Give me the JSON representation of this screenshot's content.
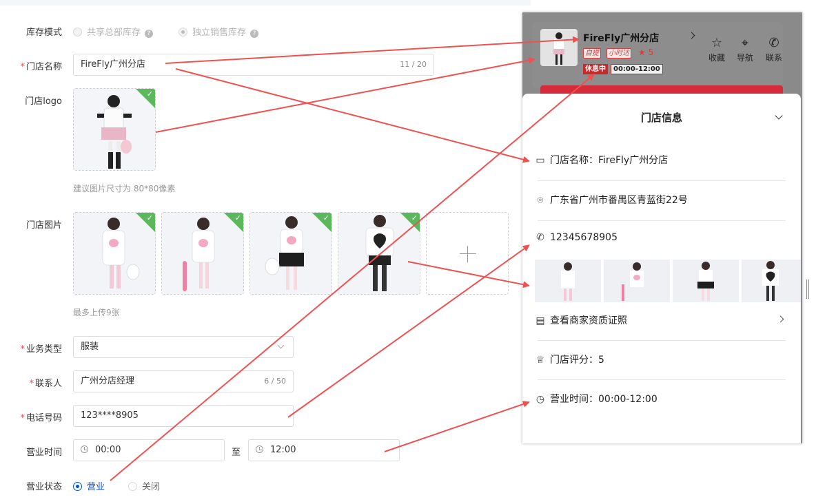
{
  "form": {
    "inventory_mode": {
      "label": "库存模式",
      "opt1": "共享总部库存",
      "opt2": "独立销售库存",
      "q": "?"
    },
    "store_name": {
      "label": "门店名称",
      "value": "FireFly广州分店",
      "count": "11 / 20"
    },
    "logo": {
      "label": "门店logo",
      "hint": "建议图片尺寸为 80*80像素"
    },
    "images": {
      "label": "门店图片",
      "hint": "最多上传9张"
    },
    "business_type": {
      "label": "业务类型",
      "value": "服装"
    },
    "contact": {
      "label": "联系人",
      "value": "广州分店经理",
      "count": "6 / 50"
    },
    "phone": {
      "label": "电话号码",
      "value": "123****8905"
    },
    "hours": {
      "label": "营业时间",
      "start": "00:00",
      "to": "至",
      "end": "12:00"
    },
    "status": {
      "label": "营业状态",
      "opt1": "营业",
      "opt2": "关闭"
    },
    "required_mark": "*",
    "check": "✓"
  },
  "preview": {
    "store_title": "FireFly广州分店",
    "tag1": "自提",
    "tag2": "小时达",
    "rating": "★ 5",
    "status_badge": "休息中",
    "hours_badge": "00:00-12:00",
    "actions": [
      {
        "label": "收藏",
        "icon": "☆"
      },
      {
        "label": "导航",
        "icon": "⌖"
      },
      {
        "label": "联系",
        "icon": "✆"
      }
    ],
    "sheet_title": "门店信息",
    "rows": {
      "name": "门店名称：FireFly广州分店",
      "address": "广东省广州市番禺区青蓝街22号",
      "phone": "12345678905",
      "license": "查看商家资质证照",
      "score": "门店评分：5",
      "hours": "营业时间：00:00-12:00"
    },
    "icons": {
      "store": "▭",
      "pin": "⌾",
      "phone": "✆",
      "license": "▤",
      "trophy": "♕",
      "clock": "◷"
    }
  },
  "colors": {
    "accent": "#0052d9",
    "required": "#e34d59",
    "arrow": "#f05050",
    "check_badge": "#5cb85c"
  }
}
